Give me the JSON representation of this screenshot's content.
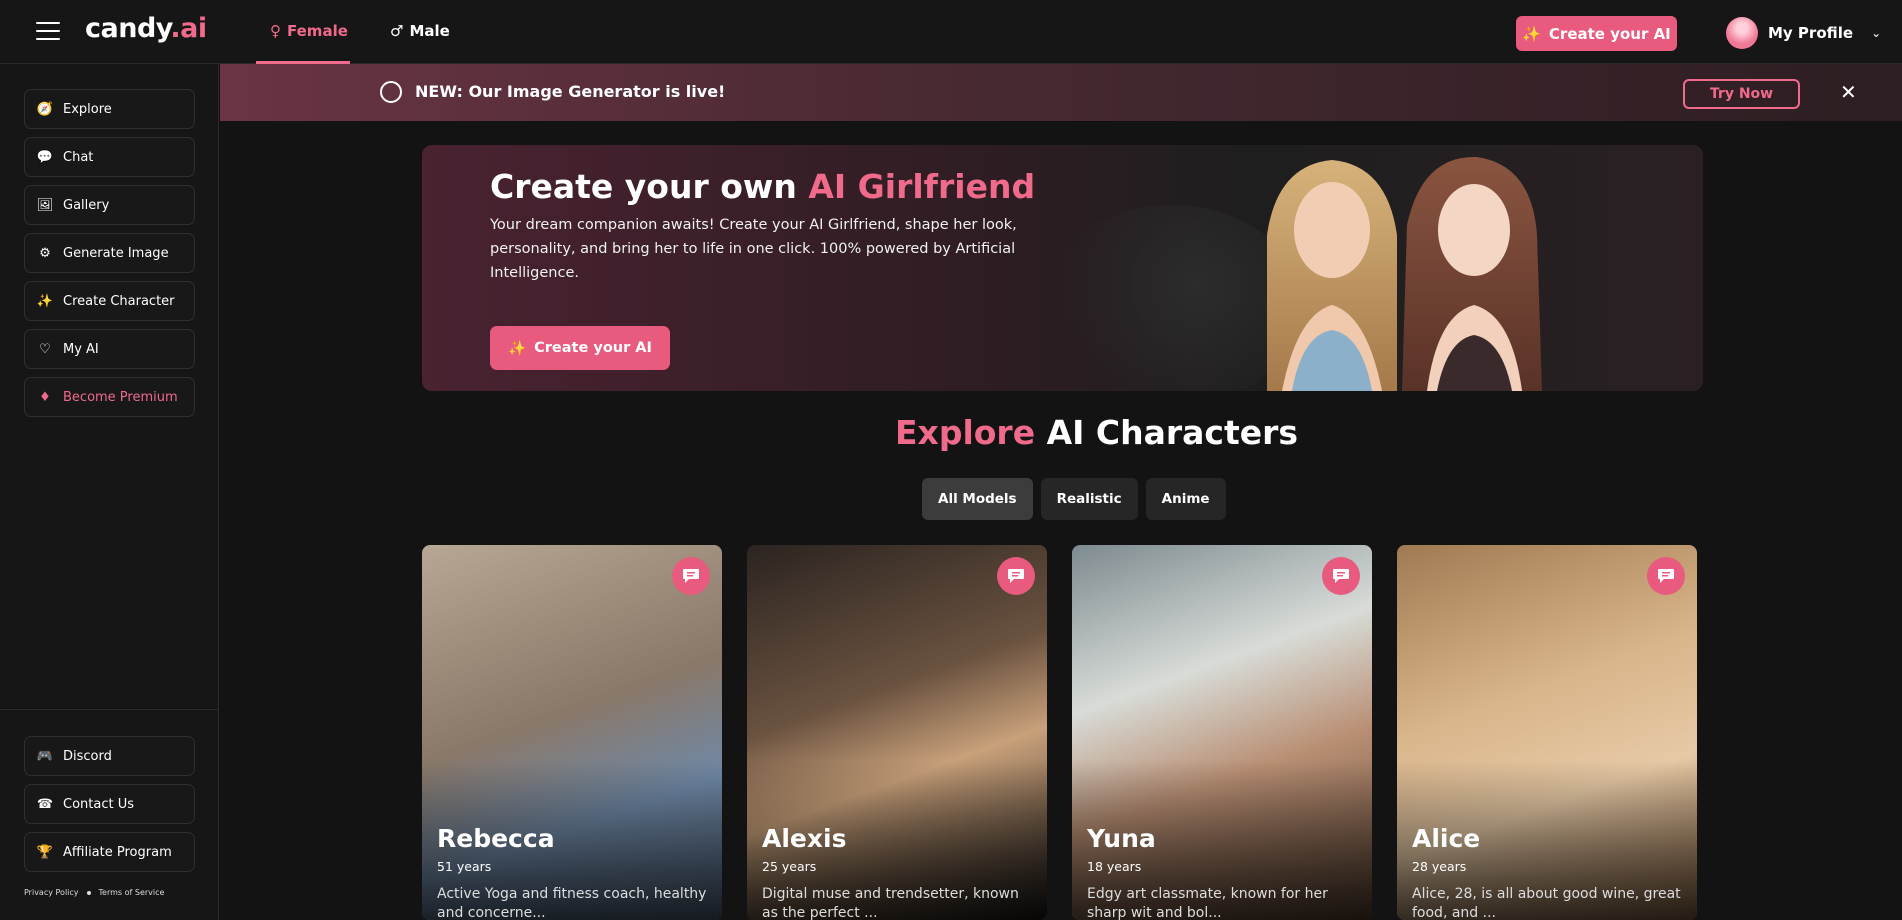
{
  "header": {
    "logo_main": "candy",
    "logo_suffix": ".ai",
    "tabs": [
      {
        "label": "Female",
        "icon": "female-icon",
        "active": true
      },
      {
        "label": "Male",
        "icon": "male-icon",
        "active": false
      }
    ],
    "create_button": "Create your AI",
    "profile_label": "My Profile"
  },
  "sidebar": {
    "items": [
      {
        "label": "Explore",
        "icon": "compass-icon"
      },
      {
        "label": "Chat",
        "icon": "chat-icon"
      },
      {
        "label": "Gallery",
        "icon": "gallery-icon"
      },
      {
        "label": "Generate Image",
        "icon": "generate-image-icon"
      },
      {
        "label": "Create Character",
        "icon": "magic-wand-icon"
      },
      {
        "label": "My AI",
        "icon": "heart-hands-icon"
      },
      {
        "label": "Become Premium",
        "icon": "diamond-icon"
      }
    ],
    "bottom_items": [
      {
        "label": "Discord",
        "icon": "discord-icon"
      },
      {
        "label": "Contact Us",
        "icon": "contact-icon"
      },
      {
        "label": "Affiliate Program",
        "icon": "trophy-icon"
      }
    ],
    "legal": {
      "privacy": "Privacy Policy",
      "terms": "Terms of Service"
    }
  },
  "banner": {
    "prefix": "NEW:",
    "text": "Our Image Generator is live!",
    "cta": "Try Now"
  },
  "hero": {
    "title_plain": "Create your own ",
    "title_accent": "AI Girlfriend",
    "description": "Your dream companion awaits! Create your AI Girlfriend, shape her look, personality, and bring her to life in one click. 100% powered by Artificial Intelligence.",
    "button": "Create your AI"
  },
  "explore": {
    "title_accent": "Explore",
    "title_plain": " AI Characters",
    "filters": [
      "All Models",
      "Realistic",
      "Anime"
    ],
    "active_filter": "All Models"
  },
  "characters": [
    {
      "name": "Rebecca",
      "age": "51 years",
      "desc": "Active Yoga and fitness coach, healthy and concerne..."
    },
    {
      "name": "Alexis",
      "age": "25 years",
      "desc": "Digital muse and trendsetter, known as the perfect ..."
    },
    {
      "name": "Yuna",
      "age": "18 years",
      "desc": "Edgy art classmate, known for her sharp wit and bol..."
    },
    {
      "name": "Alice",
      "age": "28 years",
      "desc": "Alice, 28, is all about good wine, great food, and ..."
    }
  ],
  "colors": {
    "accent": "#e85a7e",
    "accent_text": "#f06a8b",
    "background": "#131313"
  }
}
